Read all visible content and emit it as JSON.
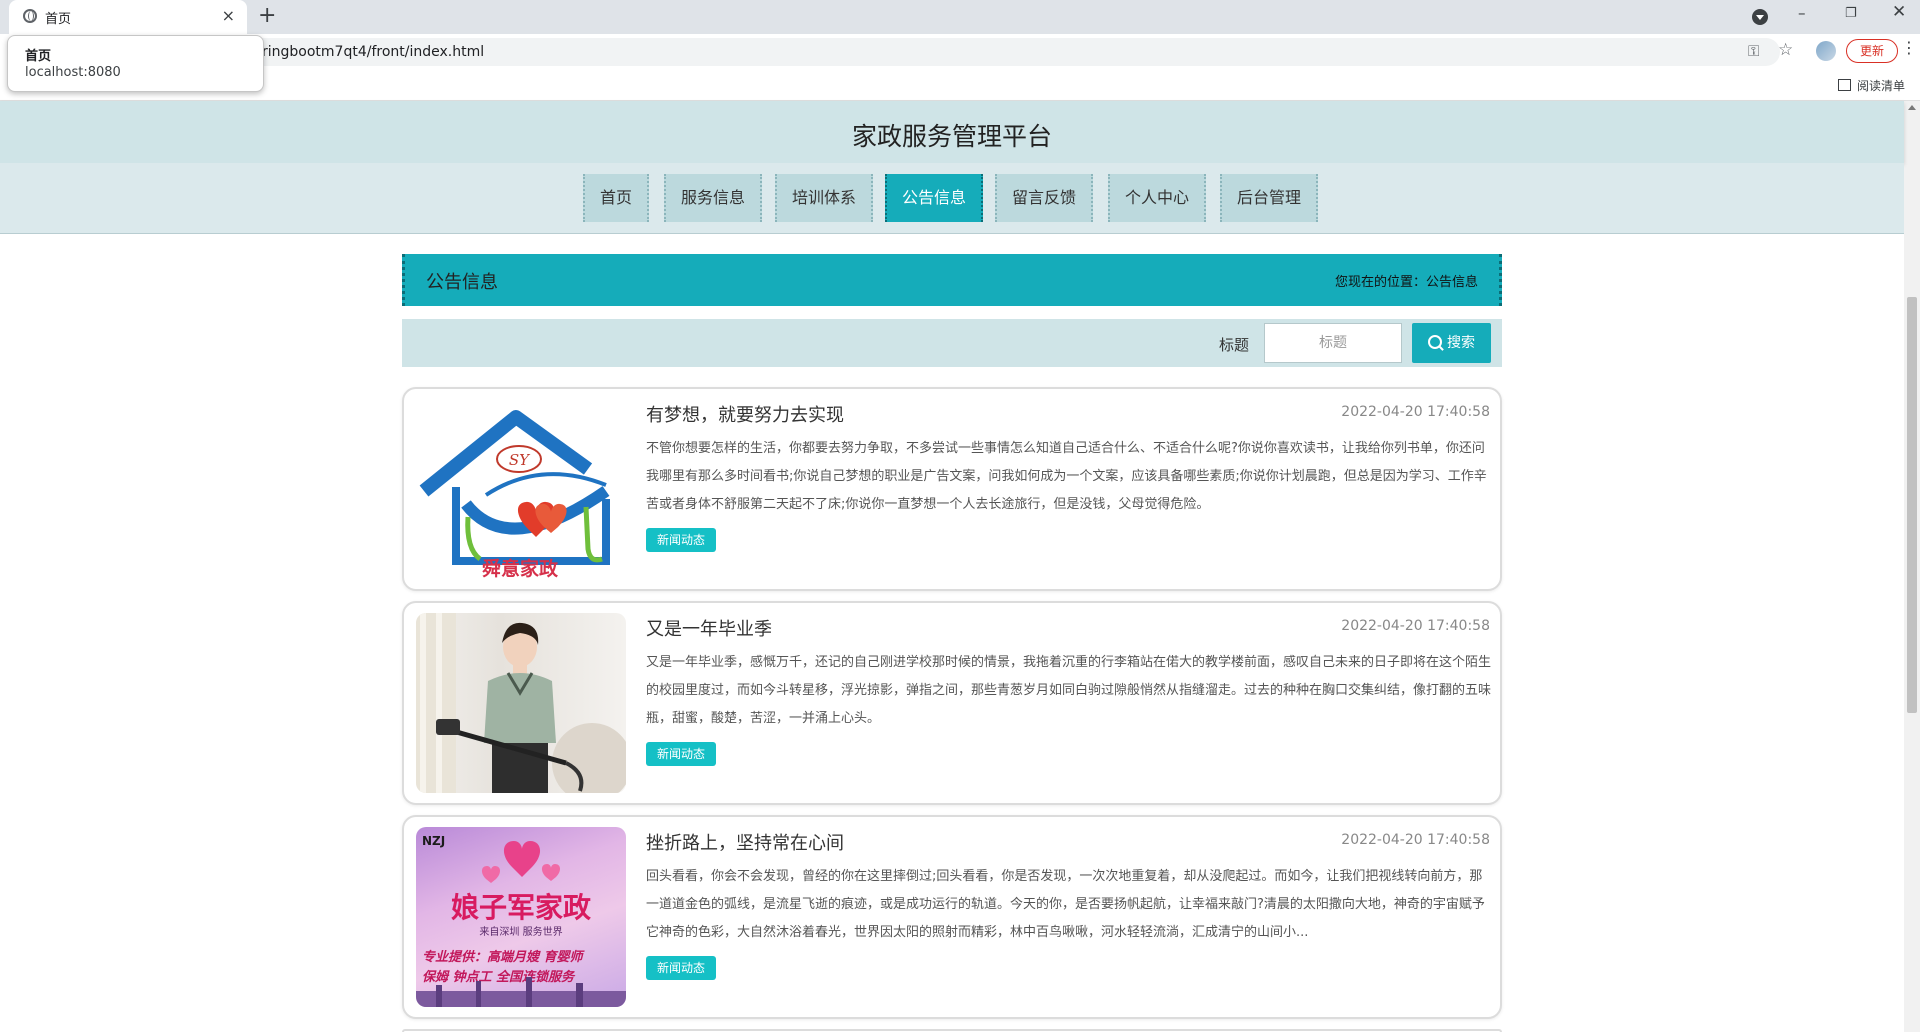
{
  "browser": {
    "tab_title": "首页",
    "new_tab": "+",
    "tab_close": "×",
    "url": "ringbootm7qt4/front/index.html",
    "update_label": "更新",
    "reading_list": "阅读清单",
    "tooltip": {
      "title": "首页",
      "url": "localhost:8080"
    }
  },
  "site": {
    "title": "家政服务管理平台"
  },
  "nav": {
    "items": [
      {
        "label": "首页"
      },
      {
        "label": "服务信息"
      },
      {
        "label": "培训体系"
      },
      {
        "label": "公告信息"
      },
      {
        "label": "留言反馈"
      },
      {
        "label": "个人中心"
      },
      {
        "label": "后台管理"
      }
    ],
    "active": "公告信息"
  },
  "section": {
    "title": "公告信息",
    "breadcrumb": "您现在的位置：公告信息"
  },
  "search": {
    "label": "标题",
    "placeholder": "标题",
    "button": "搜索"
  },
  "news": [
    {
      "title": "有梦想，就要努力去实现",
      "date": "2022-04-20 17:40:58",
      "summary": "不管你想要怎样的生活，你都要去努力争取，不多尝试一些事情怎么知道自己适合什么、不适合什么呢?你说你喜欢读书，让我给你列书单，你还问我哪里有那么多时间看书;你说自己梦想的职业是广告文案，问我如何成为一个文案，应该具备哪些素质;你说你计划晨跑，但总是因为学习、工作辛苦或者身体不舒服第二天起不了床;你说你一直梦想一个人去长途旅行，但是没钱，父母觉得危险。",
      "tag": "新闻动态",
      "logo_text": "舜意家政",
      "logo_mark": "SY"
    },
    {
      "title": "又是一年毕业季",
      "date": "2022-04-20 17:40:58",
      "summary": "又是一年毕业季，感慨万千，还记的自己刚进学校那时候的情景，我拖着沉重的行李箱站在偌大的教学楼前面，感叹自己未来的日子即将在这个陌生的校园里度过，而如今斗转星移，浮光掠影，弹指之间，那些青葱岁月如同白驹过隙般悄然从指缝溜走。过去的种种在胸口交集纠结，像打翻的五味瓶，甜蜜，酸楚，苦涩，一并涌上心头。",
      "tag": "新闻动态"
    },
    {
      "title": "挫折路上，坚持常在心间",
      "date": "2022-04-20 17:40:58",
      "summary": "回头看看，你会不会发现，曾经的你在这里摔倒过;回头看看，你是否发现，一次次地重复着，却从没爬起过。而如今，让我们把视线转向前方，那一道道金色的弧线，是流星飞逝的痕迹，或是成功运行的轨道。今天的你，是否要扬帆起航，让幸福来敲门?清晨的太阳撒向大地，神奇的宇宙赋予它神奇的色彩，大自然沐浴着春光，世界因太阳的照射而精彩，林中百鸟啾啾，河水轻轻流淌，汇成清宁的山间小...",
      "tag": "新闻动态",
      "poster": {
        "brand": "NZJ",
        "title": "娘子军家政",
        "sub": "来自深圳  服务世界",
        "line1": "专业提供：高端月嫂  育婴师",
        "line2": "保姆  钟点工  全国连锁服务"
      }
    }
  ]
}
